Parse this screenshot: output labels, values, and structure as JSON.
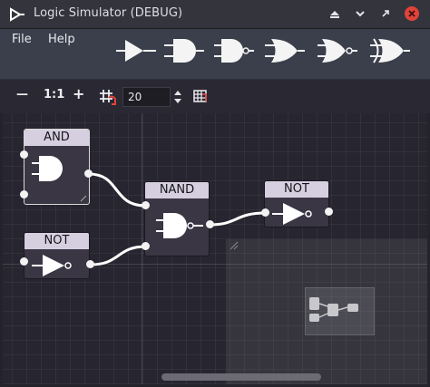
{
  "window": {
    "title": "Logic Simulator (DEBUG)"
  },
  "menu": {
    "file": "File",
    "help": "Help"
  },
  "palette": [
    "buffer-gate",
    "and-gate",
    "nand-gate",
    "or-gate",
    "nor-gate",
    "xor-gate"
  ],
  "toolbar": {
    "zoom_out": "—",
    "reset_zoom": "1:1",
    "zoom_in": "+",
    "grid_size": "20"
  },
  "nodes": {
    "and": {
      "title": "AND"
    },
    "nand": {
      "title": "NAND"
    },
    "not1": {
      "title": "NOT"
    },
    "not2": {
      "title": "NOT"
    }
  },
  "colors": {
    "header": "#d6cfe0",
    "node_body": "#3a3644",
    "wire": "#ffffff",
    "accent_close": "#e0433a"
  }
}
